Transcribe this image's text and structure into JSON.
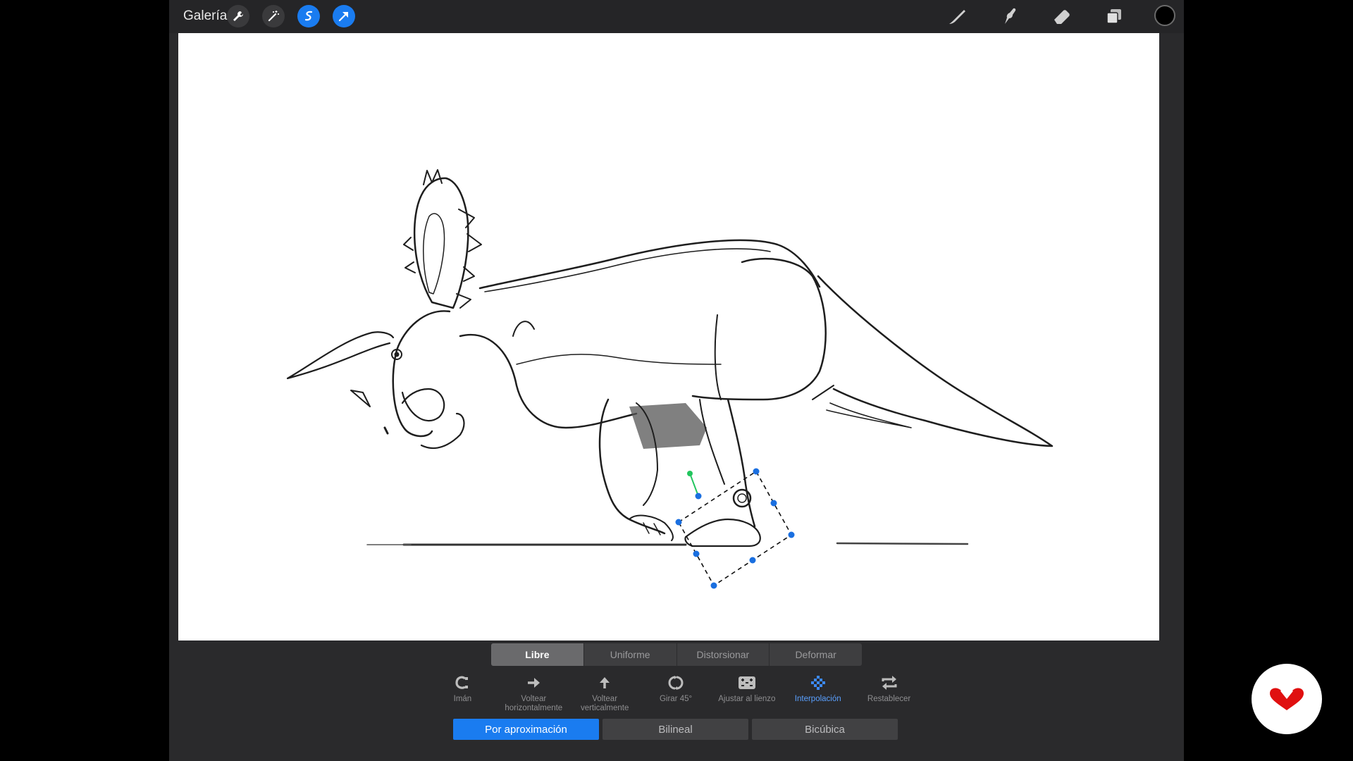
{
  "topbar": {
    "gallery_label": "Galería",
    "left_buttons": [
      "wrench-icon",
      "magic-wand-icon",
      "selection-icon",
      "transform-arrow-icon"
    ],
    "right_tools": [
      "brush-icon",
      "smudge-icon",
      "eraser-icon",
      "layers-icon"
    ],
    "color_swatch": "#000000"
  },
  "transform_modes": {
    "options": [
      "Libre",
      "Uniforme",
      "Distorsionar",
      "Deformar"
    ],
    "selected": "Libre"
  },
  "transform_options": [
    {
      "label": "Imán",
      "icon": "magnet-icon"
    },
    {
      "label": "Voltear horizontalmente",
      "icon": "arrow-right-icon"
    },
    {
      "label": "Voltear verticalmente",
      "icon": "arrow-up-icon"
    },
    {
      "label": "Girar 45°",
      "icon": "rotate-icon"
    },
    {
      "label": "Ajustar al lienzo",
      "icon": "fit-canvas-icon"
    },
    {
      "label": "Interpolación",
      "icon": "interpolation-grid-icon"
    },
    {
      "label": "Restablecer",
      "icon": "reset-arrows-icon"
    }
  ],
  "interpolation": {
    "options": [
      "Por aproximación",
      "Bilineal",
      "Bicúbica"
    ],
    "selected": "Por aproximación"
  },
  "colors": {
    "accent": "#1a7cf0",
    "handle": "#1a6fe0",
    "rotate_handle": "#22c55e",
    "logo": "#e01010"
  }
}
